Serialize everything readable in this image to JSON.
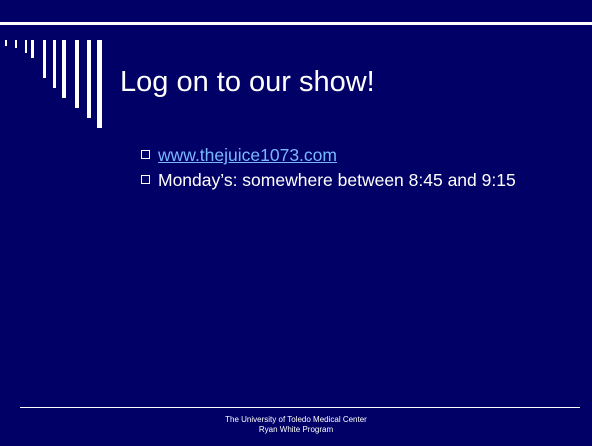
{
  "slide": {
    "title": "Log on to our show!",
    "bullets": [
      {
        "text": "www.thejuice1073.com",
        "is_link": true
      },
      {
        "text": "Monday’s: somewhere between 8:45 and 9:15",
        "is_link": false
      }
    ],
    "footer": {
      "line1": "The University of Toledo Medical Center",
      "line2": "Ryan White Program"
    }
  },
  "colors": {
    "background": "#000066",
    "text": "#ffffff",
    "link": "#79b8ff"
  },
  "icons": {
    "bullet": "hollow-square-icon",
    "decoration": "vertical-stripes-decoration"
  }
}
